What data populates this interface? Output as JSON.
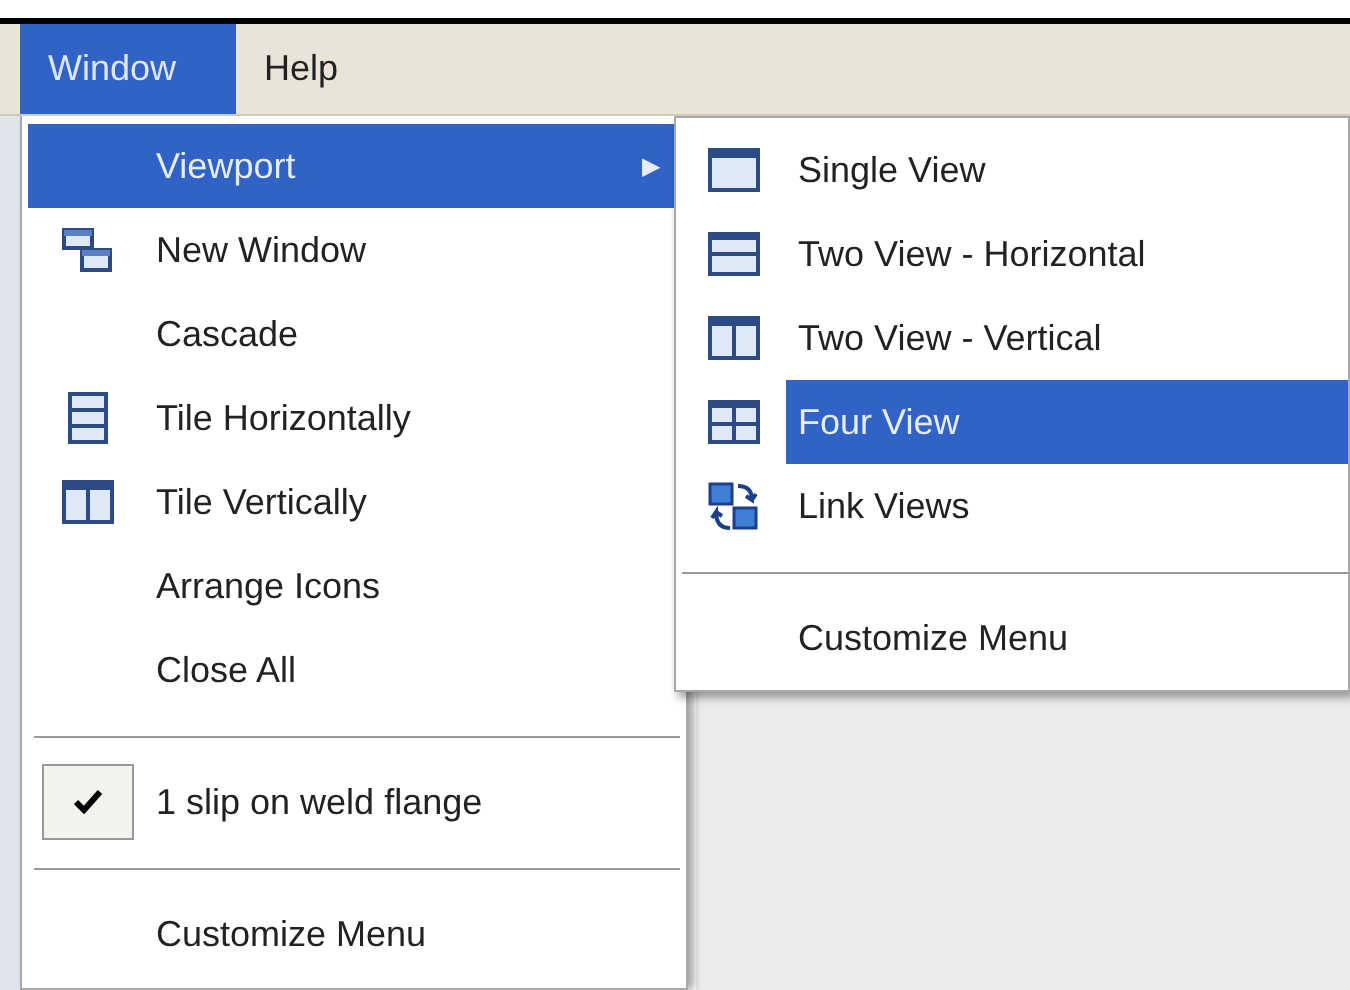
{
  "menu_bar": [
    {
      "label": "Window",
      "selected": true
    },
    {
      "label": "Help",
      "selected": false
    }
  ],
  "window_menu": [
    {
      "kind": "submenu",
      "label": "Viewport",
      "selected": true,
      "arrow": "▶"
    },
    {
      "kind": "item",
      "label": "New Window",
      "selected": false
    },
    {
      "kind": "item",
      "label": "Cascade",
      "selected": false
    },
    {
      "kind": "item",
      "label": "Tile Horizontally",
      "selected": false
    },
    {
      "kind": "item",
      "label": "Tile Vertically",
      "selected": false
    },
    {
      "kind": "item",
      "label": "Arrange Icons",
      "selected": false
    },
    {
      "kind": "item",
      "label": "Close All",
      "selected": false
    },
    {
      "kind": "separator"
    },
    {
      "kind": "check",
      "label": "1 slip on weld flange",
      "selected": false,
      "checked": true
    },
    {
      "kind": "separator"
    },
    {
      "kind": "item",
      "label": "Customize Menu",
      "selected": false
    }
  ],
  "viewport_menu": [
    {
      "kind": "item",
      "label": "Single View",
      "selected": false
    },
    {
      "kind": "item",
      "label": "Two View - Horizontal",
      "selected": false
    },
    {
      "kind": "item",
      "label": "Two View - Vertical",
      "selected": false
    },
    {
      "kind": "item",
      "label": "Four View",
      "selected": true
    },
    {
      "kind": "item",
      "label": "Link Views",
      "selected": false
    },
    {
      "kind": "separator"
    },
    {
      "kind": "item",
      "label": "Customize Menu",
      "selected": false
    }
  ]
}
